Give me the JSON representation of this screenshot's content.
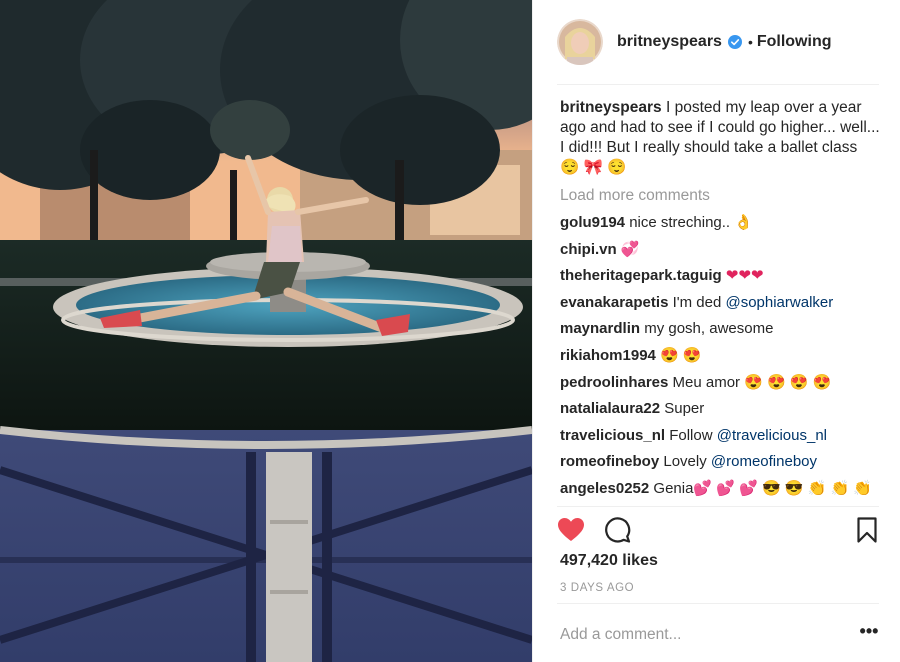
{
  "post": {
    "username": "britneyspears",
    "follow_state": "Following",
    "dot": "•",
    "caption": "I posted my leap over a year ago and had to see if I could go higher... well... I did!!! But I really should take a ballet class 😌 🎀 😌",
    "load_more": "Load more comments",
    "comments": [
      {
        "user": "golu9194",
        "text": "nice streching.. 👌"
      },
      {
        "user": "chipi.vn",
        "text": "💞"
      },
      {
        "user": "theheritagepark.taguig",
        "text": "❤❤❤"
      },
      {
        "user": "evanakarapetis",
        "text": "I'm ded ",
        "mention": "@sophiarwalker"
      },
      {
        "user": "maynardlin",
        "text": "my gosh, awesome"
      },
      {
        "user": "rikiahom1994",
        "text": "😍 😍"
      },
      {
        "user": "pedroolinhares",
        "text": "Meu amor 😍 😍 😍 😍"
      },
      {
        "user": "natalialaura22",
        "text": "Super"
      },
      {
        "user": "travelicious_nl",
        "text": "Follow ",
        "mention": "@travelicious_nl"
      },
      {
        "user": "romeofineboy",
        "text": "Lovely ",
        "mention": "@romeofineboy"
      },
      {
        "user": "angeles0252",
        "text": "Genia💕 💕 💕 😎 😎 👏 👏 👏"
      }
    ],
    "likes": "497,420 likes",
    "time": "3 DAYS AGO",
    "add_comment_placeholder": "Add a comment...",
    "more_options": "•••"
  },
  "icons": {
    "like": "heart-filled-icon",
    "comment": "speech-bubble-icon",
    "save": "bookmark-icon",
    "verified": "verified-badge-icon",
    "more": "ellipsis-icon"
  },
  "colors": {
    "like_red": "#ed4956",
    "verified_blue": "#3897f0",
    "text": "#262626",
    "muted": "#999999",
    "mention": "#003569"
  }
}
